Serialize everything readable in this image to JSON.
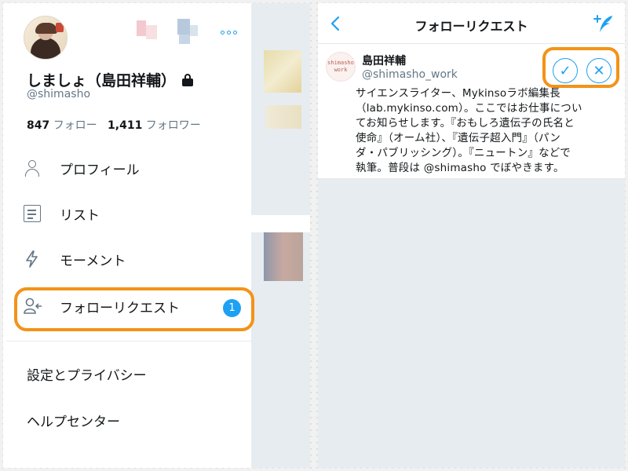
{
  "drawer": {
    "profile": {
      "display_name": "しましょ（島田祥輔）",
      "handle": "@shimasho",
      "following_count": "847",
      "following_label": "フォロー",
      "followers_count": "1,411",
      "followers_label": "フォロワー"
    },
    "menu": [
      {
        "label": "プロフィール",
        "icon": "person-icon"
      },
      {
        "label": "リスト",
        "icon": "list-icon"
      },
      {
        "label": "モーメント",
        "icon": "lightning-icon"
      },
      {
        "label": "フォローリクエスト",
        "icon": "follow-request-icon",
        "badge": "1"
      }
    ],
    "settings": [
      {
        "label": "設定とプライバシー"
      },
      {
        "label": "ヘルプセンター"
      }
    ]
  },
  "follow_requests": {
    "title": "フォローリクエスト",
    "request": {
      "avatar_text": [
        "shimasho",
        "work"
      ],
      "name": "島田祥輔",
      "handle": "@shimasho_work",
      "bio_lines": [
        "サイエンスライター、Mykinsoラボ編集長",
        "（lab.mykinso.com）。ここではお仕事につい",
        "てお知らせします。『おもしろ遺伝子の氏名と",
        "使命』（オーム社）、『遺伝子超入門』（パン",
        "ダ・パブリッシング）。『ニュートン』などで",
        "執筆。普段は @shimasho でぼやきます。"
      ],
      "accept_symbol": "✓",
      "decline_symbol": "✕"
    }
  },
  "colors": {
    "accent": "#1da1f2",
    "highlight": "#f39318",
    "muted": "#657786",
    "text": "#14171a"
  }
}
